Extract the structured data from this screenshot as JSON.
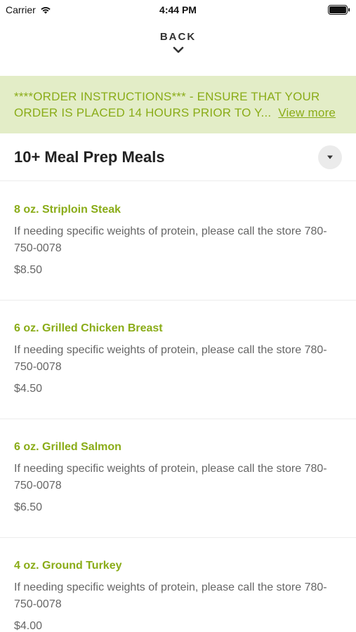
{
  "status_bar": {
    "carrier": "Carrier",
    "time": "4:44 PM"
  },
  "nav": {
    "back_label": "BACK"
  },
  "banner": {
    "text": "****ORDER INSTRUCTIONS*** - ENSURE THAT YOUR ORDER IS PLACED 14 HOURS PRIOR TO Y...",
    "view_more": "View more"
  },
  "category": {
    "title": "10+ Meal Prep Meals"
  },
  "items": [
    {
      "name": "8 oz. Striploin Steak",
      "description": "If needing specific weights of protein, please call the store 780-750-0078",
      "price": "$8.50"
    },
    {
      "name": "6 oz. Grilled Chicken Breast",
      "description": "If needing specific weights of protein, please call the store 780-750-0078",
      "price": "$4.50"
    },
    {
      "name": "6 oz. Grilled Salmon",
      "description": "If needing specific weights of protein, please call the store 780-750-0078",
      "price": "$6.50"
    },
    {
      "name": "4 oz. Ground Turkey",
      "description": "If needing specific weights of protein, please call the store 780-750-0078",
      "price": "$4.00"
    }
  ],
  "colors": {
    "accent": "#8aac18",
    "banner_bg": "#e3edc7"
  },
  "icons": {
    "wifi": "wifi-icon",
    "battery": "battery-icon",
    "back": "chevron-down-icon",
    "dropdown": "caret-down-icon"
  }
}
